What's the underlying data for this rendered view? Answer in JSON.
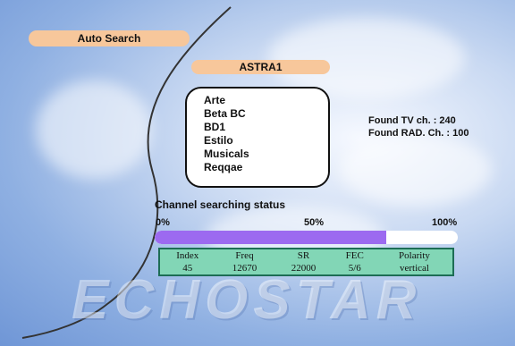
{
  "header": {
    "title": "Auto Search"
  },
  "satellite": {
    "name": "ASTRA1"
  },
  "channels": [
    "Arte",
    "Beta BC",
    "BD1",
    "Estilo",
    "Musicals",
    "Reqqae"
  ],
  "found": {
    "tv_line": "Found TV ch.  : 240",
    "radio_line": "Found RAD. Ch. : 100"
  },
  "status": {
    "label": "Channel searching status",
    "pct_start": "0%",
    "pct_mid": "50%",
    "pct_end": "100%",
    "progress": 0.765,
    "fill_color": "#9c6af0"
  },
  "table": {
    "headers": [
      "Index",
      "Freq",
      "SR",
      "FEC",
      "Polarity"
    ],
    "values": [
      "45",
      "12670",
      "22000",
      "5/6",
      "vertical"
    ]
  },
  "logo": {
    "text": "ECHOSTAR"
  },
  "colors": {
    "accent_pill": "#f7c79b",
    "table_bg": "#82d6b6"
  }
}
